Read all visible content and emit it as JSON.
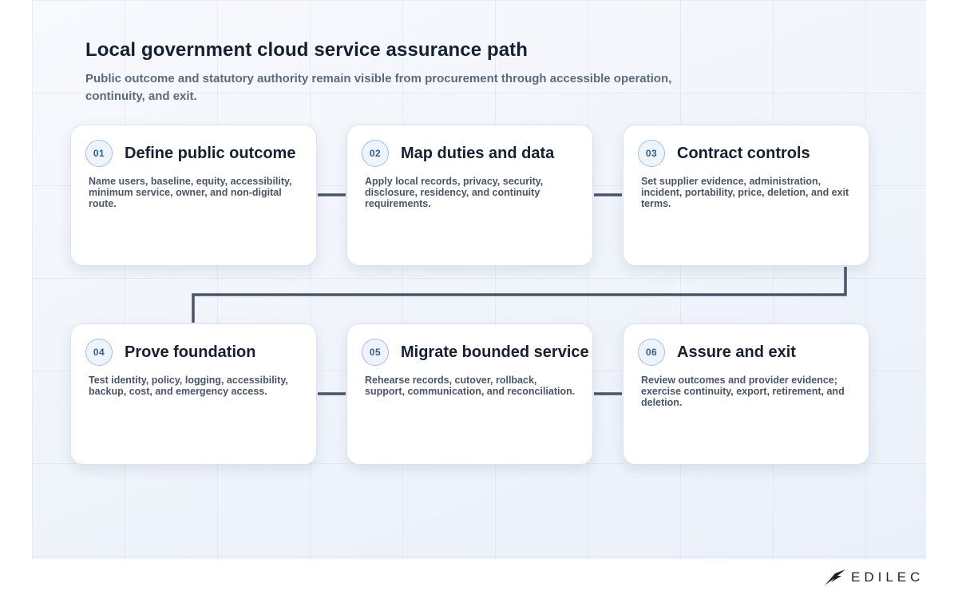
{
  "title": "Local government cloud service assurance path",
  "subtitle": "Public outcome and statutory authority remain visible from procurement through accessible operation, continuity, and exit.",
  "steps": [
    {
      "number": "01",
      "title": "Define public outcome",
      "description": "Name users, baseline, equity, accessibility, minimum service, owner, and non-digital route."
    },
    {
      "number": "02",
      "title": "Map duties and data",
      "description": "Apply local records, privacy, security, disclosure, residency, and continuity requirements."
    },
    {
      "number": "03",
      "title": "Contract controls",
      "description": "Set supplier evidence, administration, incident, portability, price, deletion, and exit terms."
    },
    {
      "number": "04",
      "title": "Prove foundation",
      "description": "Test identity, policy, logging, accessibility, backup, cost, and emergency access."
    },
    {
      "number": "05",
      "title": "Migrate bounded service",
      "description": "Rehearse records, cutover, rollback, support, communication, and reconciliation."
    },
    {
      "number": "06",
      "title": "Assure and exit",
      "description": "Review outcomes and provider evidence; exercise continuity, export, retirement, and deletion."
    }
  ],
  "brand": {
    "logo_text": "EDILEC",
    "logo_icon": "swoosh-icon"
  },
  "colors": {
    "connector": "#4a5568",
    "badge_border": "#9fc0ea",
    "badge_text": "#2f5d9e",
    "title": "#152033"
  }
}
